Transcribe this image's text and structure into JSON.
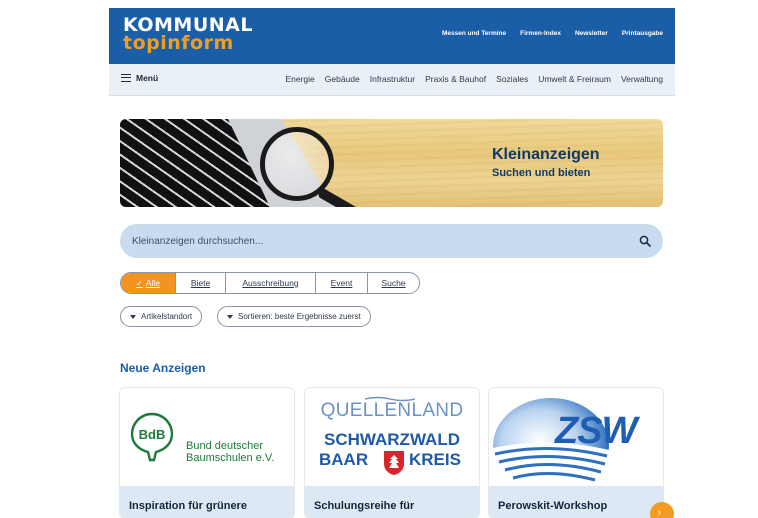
{
  "header": {
    "logo_line1": "KOMMUNAL",
    "logo_line2": "topinform",
    "links": [
      "Messen und Termine",
      "Firmen-Index",
      "Newsletter",
      "Printausgabe"
    ]
  },
  "nav": {
    "menu_label": "Menü",
    "items": [
      "Energie",
      "Gebäude",
      "Infrastruktur",
      "Praxis & Bauhof",
      "Soziales",
      "Umwelt & Freiraum",
      "Verwaltung"
    ]
  },
  "banner": {
    "title": "Kleinanzeigen",
    "subtitle": "Suchen und bieten"
  },
  "search": {
    "placeholder": "Kleinanzeigen durchsuchen..."
  },
  "filters": {
    "options": [
      "Alle",
      "Biete",
      "Ausschreibung",
      "Event",
      "Suche"
    ],
    "selected": "Alle"
  },
  "sort": {
    "location_label": "Artikelstandort",
    "order_label": "Sortieren: beste Ergebnisse zuerst"
  },
  "listings": {
    "section_title": "Neue Anzeigen",
    "cards": [
      {
        "title": "Inspiration für grünere",
        "logo_abbr": "BdB",
        "logo_text_line1": "Bund deutscher",
        "logo_text_line2": "Baumschulen e.V."
      },
      {
        "title": "Schulungsreihe für",
        "logo_line1": "QUELLENLAND",
        "logo_line2": "SCHWARZWALD",
        "logo_line3a": "BAAR",
        "logo_line3b": "KREIS"
      },
      {
        "title": "Perowskit-Workshop",
        "logo_text": "ZSW"
      }
    ]
  },
  "colors": {
    "brand_blue": "#1a5ea8",
    "accent_orange": "#f39c22",
    "nav_bg": "#e9f0f8",
    "search_bg": "#c9dbee"
  },
  "icons": {
    "menu": "hamburger-icon",
    "search": "search-icon",
    "dropdown": "caret-down-icon",
    "check": "check-icon",
    "fab": "arrow-icon"
  }
}
